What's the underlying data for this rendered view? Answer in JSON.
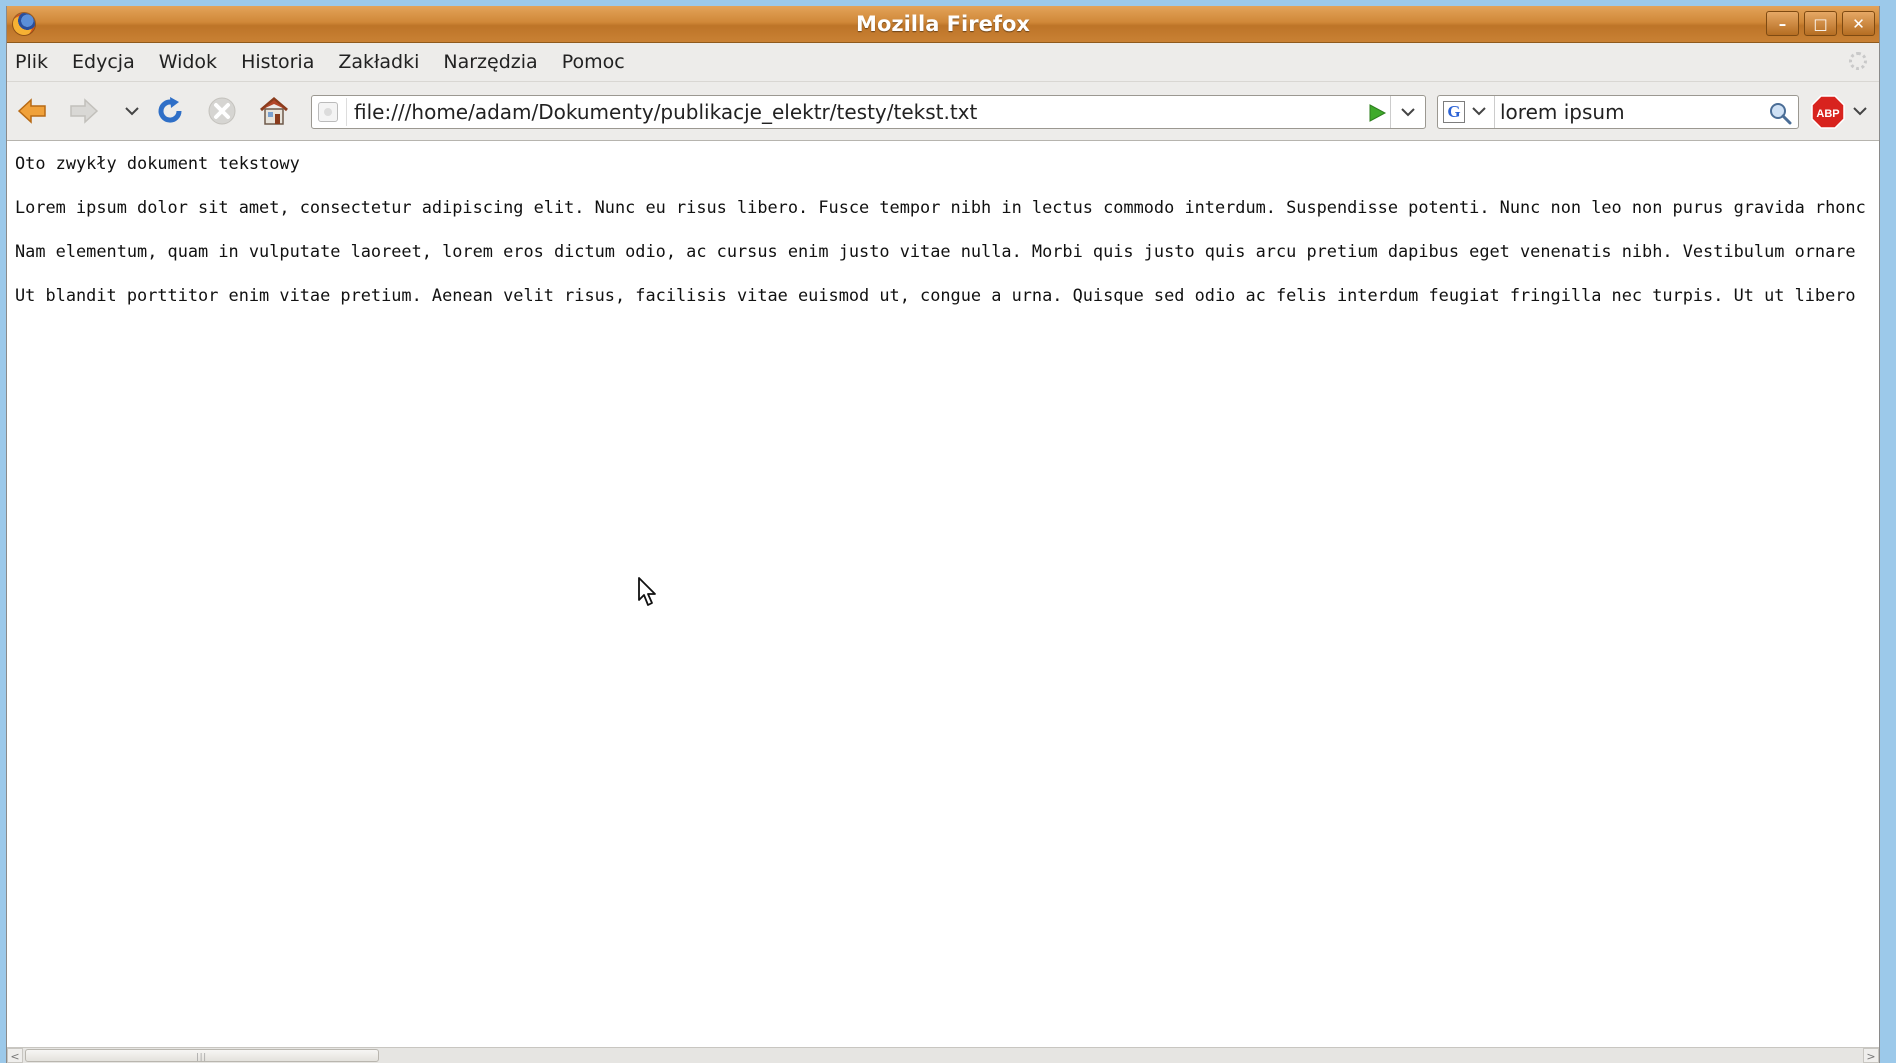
{
  "window": {
    "title": "Mozilla Firefox",
    "buttons": [
      "minimize",
      "maximize",
      "close"
    ]
  },
  "menubar": {
    "items": [
      "Plik",
      "Edycja",
      "Widok",
      "Historia",
      "Zakładki",
      "Narzędzia",
      "Pomoc"
    ]
  },
  "toolbar": {
    "icons": [
      "back-arrow-icon",
      "forward-arrow-icon",
      "history-dropdown-icon",
      "reload-icon",
      "stop-icon",
      "home-icon"
    ],
    "url": "file:///home/adam/Dokumenty/publikacje_elektr/testy/tekst.txt",
    "search_engine": "G",
    "search_value": "lorem ipsum",
    "addon": "ABP"
  },
  "document": {
    "lines": [
      "Oto zwykły dokument tekstowy",
      "Lorem ipsum dolor sit amet, consectetur adipiscing elit. Nunc eu risus libero. Fusce tempor nibh in lectus commodo interdum. Suspendisse potenti. Nunc non leo non purus gravida rhonc",
      "Nam elementum, quam in vulputate laoreet, lorem eros dictum odio, ac cursus enim justo vitae nulla. Morbi quis justo quis arcu pretium dapibus eget venenatis nibh. Vestibulum ornare",
      "Ut blandit porttitor enim vitae pretium. Aenean velit risus, facilisis vitae euismod ut, congue a urna. Quisque sed odio ac felis interdum feugiat fringilla nec turpis. Ut ut libero"
    ]
  },
  "scrollbar": {
    "horizontal_position": 0.0
  },
  "colors": {
    "titlebar": "#c98134",
    "chrome": "#edecea",
    "background": "#9cc9ea"
  }
}
